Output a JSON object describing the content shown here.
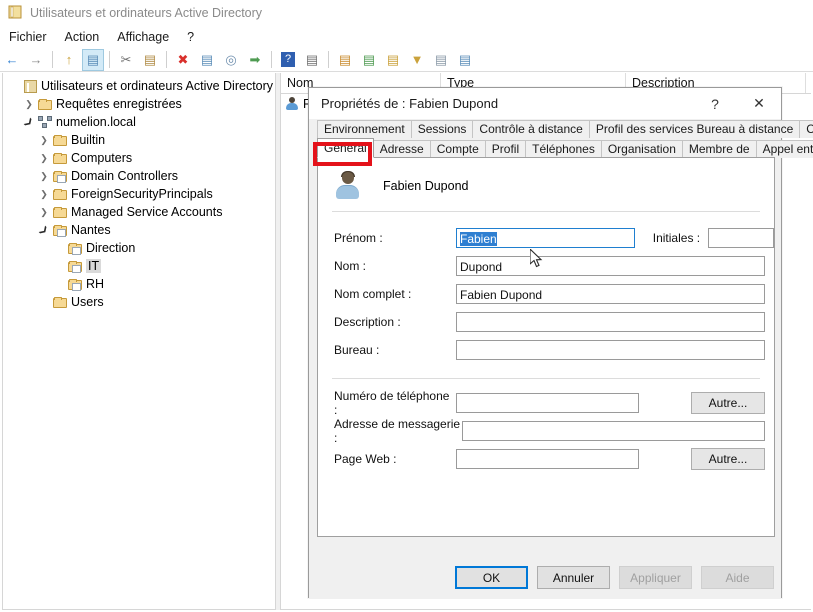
{
  "window": {
    "title": "Utilisateurs et ordinateurs Active Directory",
    "icon": "console-icon",
    "menus": [
      {
        "label": "Fichier",
        "name": "menu-fichier"
      },
      {
        "label": "Action",
        "name": "menu-action"
      },
      {
        "label": "Affichage",
        "name": "menu-affichage"
      },
      {
        "label": "?",
        "name": "menu-help"
      }
    ],
    "toolbar": [
      {
        "name": "back-icon",
        "glyph": "←",
        "color": "#2f7fd1",
        "pressed": false
      },
      {
        "name": "forward-icon",
        "glyph": "→",
        "color": "#8a8a8a",
        "pressed": false
      },
      {
        "sep": true
      },
      {
        "name": "up-folder-icon",
        "glyph": "↑",
        "color": "#caa23c",
        "pressed": false
      },
      {
        "name": "show-hide-tree-icon",
        "glyph": "▤",
        "color": "#5b8db8",
        "pressed": true
      },
      {
        "sep": true
      },
      {
        "name": "cut-icon",
        "glyph": "✂",
        "color": "#6f6f6f",
        "pressed": false
      },
      {
        "name": "paste-icon",
        "glyph": "▤",
        "color": "#b08b45",
        "pressed": false
      },
      {
        "sep": true
      },
      {
        "name": "delete-icon",
        "glyph": "✖",
        "color": "#d9302c",
        "pressed": false
      },
      {
        "name": "properties-icon",
        "glyph": "▤",
        "color": "#5b8db8",
        "pressed": false
      },
      {
        "name": "find-icon",
        "glyph": "◎",
        "color": "#6f8fae",
        "pressed": false
      },
      {
        "name": "export-list-icon",
        "glyph": "➡",
        "color": "#4f9b52",
        "pressed": false
      },
      {
        "sep": true
      },
      {
        "name": "help-icon",
        "glyph": "?",
        "color": "#ffffff",
        "bg": "#2f5fb0",
        "pressed": false
      },
      {
        "name": "console-window-icon",
        "glyph": "▤",
        "color": "#6f6f6f",
        "pressed": false
      },
      {
        "sep": true
      },
      {
        "name": "new-user-icon",
        "glyph": "▤",
        "color": "#c98b2e",
        "pressed": false
      },
      {
        "name": "new-group-icon",
        "glyph": "▤",
        "color": "#4f9b52",
        "pressed": false
      },
      {
        "name": "new-ou-icon",
        "glyph": "▤",
        "color": "#caa23c",
        "pressed": false
      },
      {
        "name": "filter-icon",
        "glyph": "▼",
        "color": "#caa23c",
        "pressed": false
      },
      {
        "name": "saved-query-icon",
        "glyph": "▤",
        "color": "#8b9aa8",
        "pressed": false
      },
      {
        "name": "find-user-icon",
        "glyph": "▤",
        "color": "#5b8db8",
        "pressed": false
      }
    ]
  },
  "tree": {
    "items": [
      {
        "label": "Utilisateurs et ordinateurs Active Directory [SRV-A",
        "indent": 0,
        "chevron": "none",
        "icon": "console",
        "selected": false
      },
      {
        "label": "Requêtes enregistrées",
        "indent": 1,
        "chevron": "closed",
        "icon": "folder",
        "selected": false
      },
      {
        "label": "numelion.local",
        "indent": 1,
        "chevron": "open",
        "icon": "domain",
        "selected": false
      },
      {
        "label": "Builtin",
        "indent": 2,
        "chevron": "closed",
        "icon": "folder",
        "selected": false
      },
      {
        "label": "Computers",
        "indent": 2,
        "chevron": "closed",
        "icon": "folder",
        "selected": false
      },
      {
        "label": "Domain Controllers",
        "indent": 2,
        "chevron": "closed",
        "icon": "ou",
        "selected": false
      },
      {
        "label": "ForeignSecurityPrincipals",
        "indent": 2,
        "chevron": "closed",
        "icon": "folder",
        "selected": false
      },
      {
        "label": "Managed Service Accounts",
        "indent": 2,
        "chevron": "closed",
        "icon": "folder",
        "selected": false
      },
      {
        "label": "Nantes",
        "indent": 2,
        "chevron": "open",
        "icon": "ou",
        "selected": false
      },
      {
        "label": "Direction",
        "indent": 3,
        "chevron": "none",
        "icon": "ou",
        "selected": false
      },
      {
        "label": "IT",
        "indent": 3,
        "chevron": "none",
        "icon": "ou",
        "selected": true
      },
      {
        "label": "RH",
        "indent": 3,
        "chevron": "none",
        "icon": "ou",
        "selected": false
      },
      {
        "label": "Users",
        "indent": 2,
        "chevron": "none",
        "icon": "folder",
        "selected": false
      }
    ]
  },
  "listview": {
    "columns": [
      {
        "label": "Nom",
        "width": 160
      },
      {
        "label": "Type",
        "width": 185
      },
      {
        "label": "Description",
        "width": 180
      }
    ],
    "rows": [
      {
        "name": "F",
        "type": "",
        "description": ""
      }
    ]
  },
  "dialog": {
    "title": "Propriétés de : Fabien Dupond",
    "help_button": "?",
    "close_button": "✕",
    "tabs_row1": [
      {
        "label": "Environnement",
        "active": false
      },
      {
        "label": "Sessions",
        "active": false
      },
      {
        "label": "Contrôle à distance",
        "active": false
      },
      {
        "label": "Profil des services Bureau à distance",
        "active": false
      },
      {
        "label": "COM+",
        "active": false
      }
    ],
    "tabs_row2": [
      {
        "label": "Général",
        "active": true
      },
      {
        "label": "Adresse",
        "active": false
      },
      {
        "label": "Compte",
        "active": false
      },
      {
        "label": "Profil",
        "active": false
      },
      {
        "label": "Téléphones",
        "active": false
      },
      {
        "label": "Organisation",
        "active": false
      },
      {
        "label": "Membre de",
        "active": false
      },
      {
        "label": "Appel entrant",
        "active": false
      }
    ],
    "user_header": "Fabien Dupond",
    "fields": {
      "prenom": {
        "label": "Prénom :",
        "value": "Fabien",
        "selected": true,
        "focused": true
      },
      "initiales": {
        "label": "Initiales :",
        "value": ""
      },
      "nom": {
        "label": "Nom :",
        "value": "Dupond"
      },
      "nom_complet": {
        "label": "Nom complet :",
        "value": "Fabien Dupond"
      },
      "description": {
        "label": "Description :",
        "value": ""
      },
      "bureau": {
        "label": "Bureau :",
        "value": ""
      },
      "telephone": {
        "label": "Numéro de téléphone :",
        "value": "",
        "other": "Autre..."
      },
      "messagerie": {
        "label": "Adresse de messagerie :",
        "value": ""
      },
      "pageweb": {
        "label": "Page Web :",
        "value": "",
        "other": "Autre..."
      }
    },
    "buttons": [
      {
        "label": "OK",
        "state": "default"
      },
      {
        "label": "Annuler",
        "state": "normal"
      },
      {
        "label": "Appliquer",
        "state": "disabled"
      },
      {
        "label": "Aide",
        "state": "disabled"
      }
    ]
  },
  "annotation": {
    "color": "#e4121a",
    "target": "Général"
  }
}
